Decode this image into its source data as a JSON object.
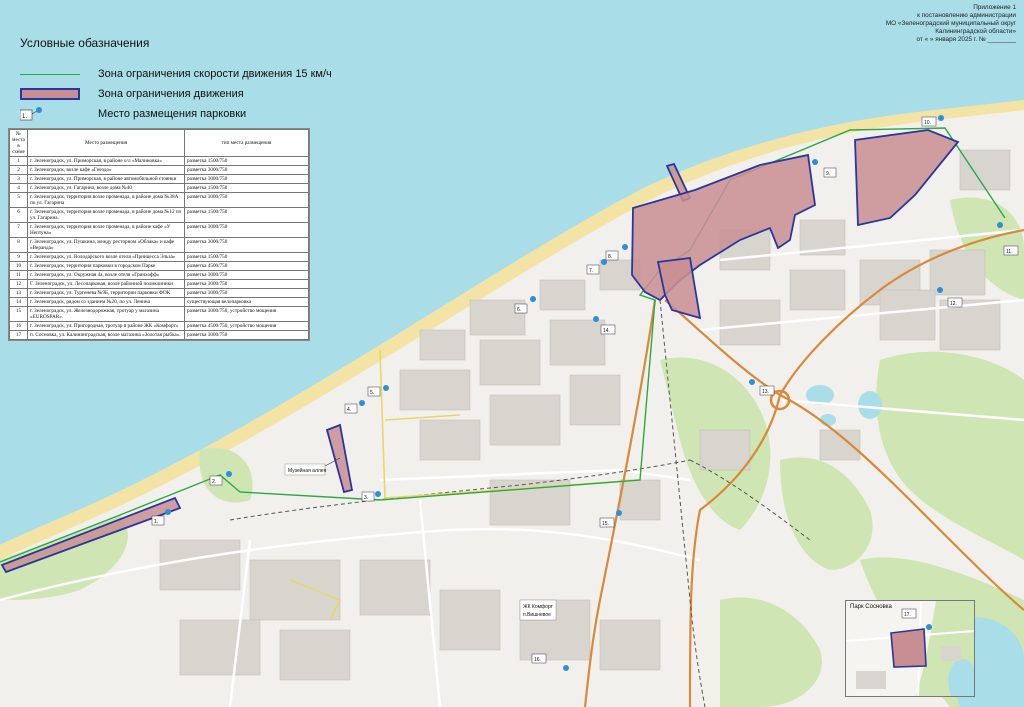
{
  "appendix": {
    "line1": "Приложение 1",
    "line2": "к постановлению администрации",
    "line3": "МО «Зеленоградский муниципальный округ",
    "line4": "Калининградской области»",
    "line5": "от «       » января 2025 г. № ________"
  },
  "legend": {
    "title": "Условные обазначения",
    "speed_zone": "Зона ограничения скорости движения 15 км/ч",
    "traffic_zone": "Зона ограничения движения",
    "parking": "Место размещения парковки",
    "parking_sample_number": "1."
  },
  "colors": {
    "sea": "#a9dde8",
    "beach": "#f3e4a6",
    "land": "#f2f0ec",
    "forest": "#cfe6b4",
    "zone_fill": "#c98e92",
    "zone_border": "#2a36a0",
    "speed_zone_line": "#2aa844",
    "main_road": "#d8893a",
    "railway": "#555555",
    "parking_marker": "#2e8fd6"
  },
  "table": {
    "headers": [
      "№ места в схеме",
      "Место размещения",
      "тип места размещения"
    ],
    "rows": [
      [
        "1",
        "г. Зеленоградск, ул. Приморская, в районе о/л «Малиновка»",
        "разметка 1500/750"
      ],
      [
        "2",
        "г. Зеленоградск, возле кафе «Гнездо»",
        "разметка 3000/750"
      ],
      [
        "3",
        "г. Зеленоградск, ул. Приморская, в районе автомобильной стоянки",
        "разметка 3000/750"
      ],
      [
        "4",
        "г. Зеленоградск, ул. Гагарина, возле дома №40",
        "разметка 1500/750"
      ],
      [
        "5",
        "г. Зеленоградск, территория возле променада, в районе дома №38А по ул. Гагарина",
        "разметка 3000/750"
      ],
      [
        "6",
        "г. Зеленоградск, территория возле променада, в районе дома №12 по ул. Гагарина.",
        "разметка 1500/750"
      ],
      [
        "7",
        "г. Зеленоградск, территория возле променада, в районе кафе «У Нептуна»",
        "разметка 3000/750"
      ],
      [
        "8",
        "г. Зеленоградск, ул. Пушкина, между ресторном «Облака» и кафе «Веранда»",
        "разметка 3000/750"
      ],
      [
        "9",
        "г. Зеленоградск, ул. Володарского возле отеля «Принцесса Эльза»",
        "разметка 1500/750"
      ],
      [
        "10",
        "г. Зеленоградск, территория парковки в городском Парке",
        "разметка 4500/750"
      ],
      [
        "11",
        "г. Зеленоградск, ул. Окружная 4а, возле отеля «Гринхофф»",
        "разметка 3000/750"
      ],
      [
        "12",
        "Г. Зеленоградск, ул. Лесопарковая, возле районной поликлиники",
        "разметка 3000/750"
      ],
      [
        "13",
        "г. Зеленоградск, ул. Тургенева №9Б, территории парковки ФОК",
        "разметка 3000/750"
      ],
      [
        "14",
        "г. Зеленоградск, рядом со зданием №20, по ул. Ленина",
        "существующая велопарковка"
      ],
      [
        "15",
        "г. Зеленоградск, ул. Железнодорожная, тротуар у магазина «EUROSPAR».",
        "разметка 3000/750, устройство мощения"
      ],
      [
        "16",
        "г. Зеленоградск, ул. Пригородная, тротуар в районе ЖК «Комфорт»",
        "разметка 4500/750, устройство мощения"
      ],
      [
        "17",
        "п. Сосновка, ул. Калининградская, возле магазина «Золотая рыбка».",
        "разметка 3000/750"
      ]
    ]
  },
  "map_labels": {
    "museum_alley": "Музейная аллея",
    "zhk_line1": "ЖК Комфорт",
    "zhk_line2": "п.Вишневое",
    "inset_title": "Парк Сосновка"
  },
  "parking_markers": [
    "1.",
    "2.",
    "3.",
    "4.",
    "5.",
    "6.",
    "7.",
    "8.",
    "9.",
    "10.",
    "11.",
    "12.",
    "13.",
    "14.",
    "15.",
    "16.",
    "17."
  ]
}
